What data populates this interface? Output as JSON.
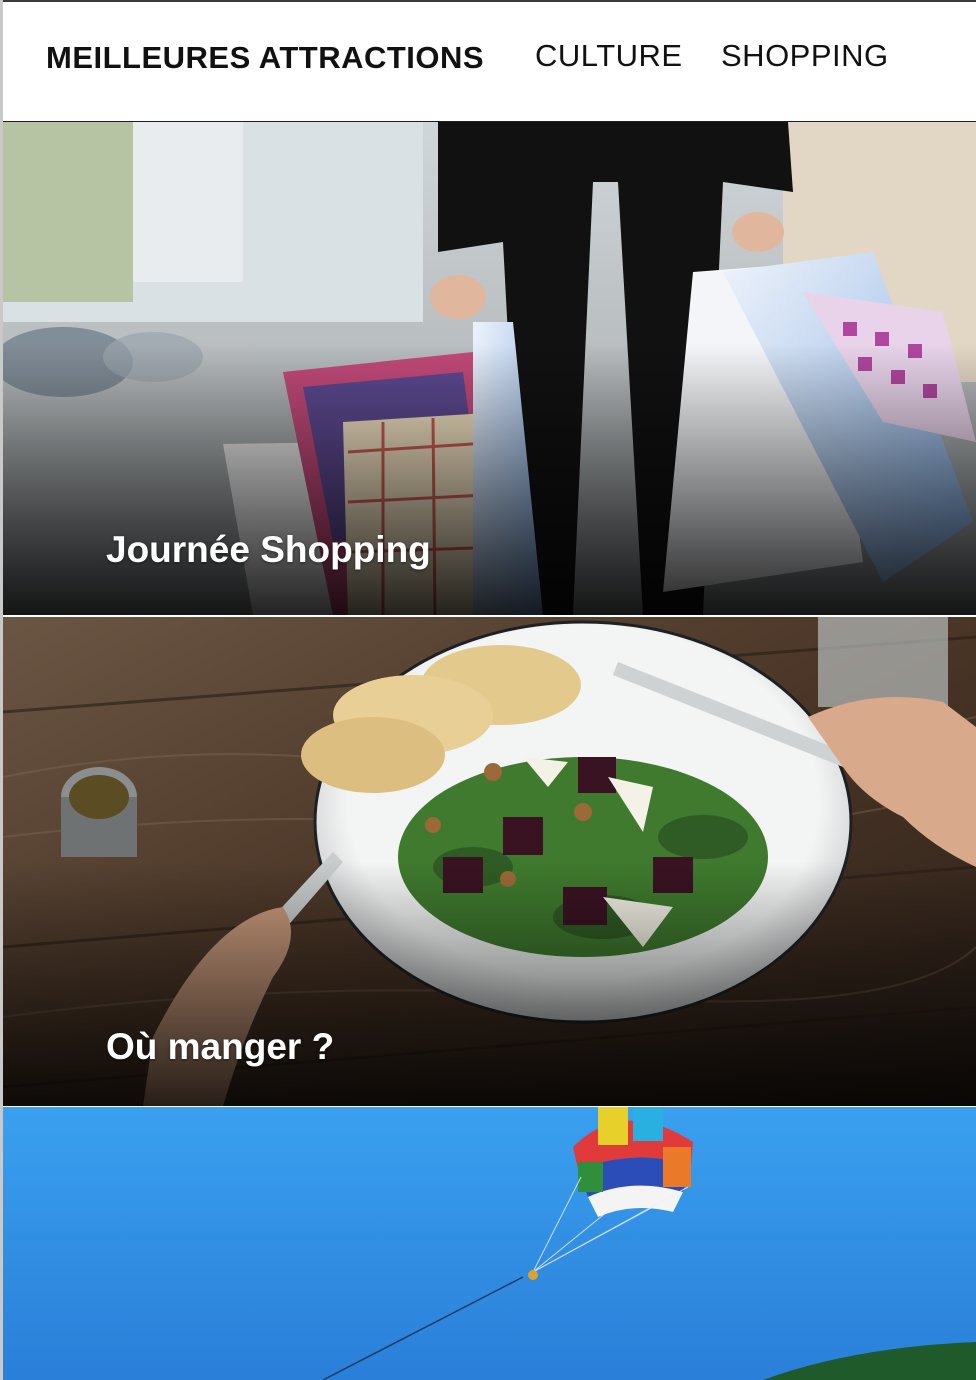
{
  "nav": {
    "items": [
      {
        "label": "MEILLEURES ATTRACTIONS",
        "active": true
      },
      {
        "label": "CULTURE",
        "active": false
      },
      {
        "label": "SHOPPING",
        "active": false
      }
    ]
  },
  "cards": [
    {
      "title": "Journée Shopping"
    },
    {
      "title": "Où manger ?"
    },
    {
      "title": ""
    }
  ],
  "colors": {
    "overlay": "#000000",
    "sky": "#2f90e8",
    "table": "#4a3526"
  }
}
